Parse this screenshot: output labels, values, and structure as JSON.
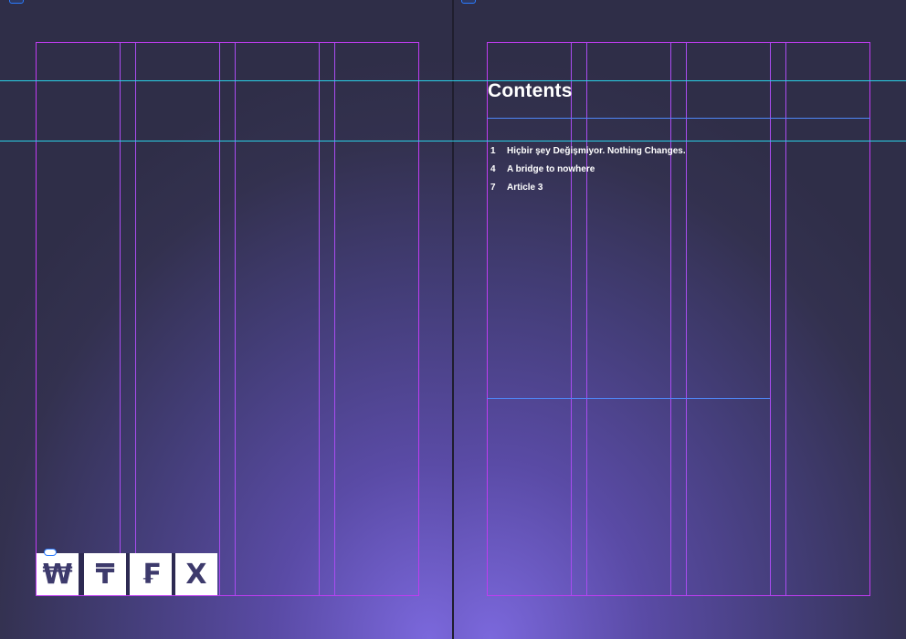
{
  "contents": {
    "title": "Contents",
    "entries": [
      {
        "page": "1",
        "title": "Hiçbir şey Değişmiyor. Nothing Changes."
      },
      {
        "page": "4",
        "title": "A bridge to nowhere"
      },
      {
        "page": "7",
        "title": "Article 3"
      }
    ]
  },
  "logo": {
    "glyphs": [
      "₩",
      "₸",
      "₣",
      "X"
    ]
  },
  "colors": {
    "margin_guide": "#c03cf2",
    "column_guide": "#a94cf0",
    "ruler_guide": "#2ad0e6",
    "frame_edge": "#4f86f7",
    "page_glow": "#7b68dc",
    "page_dark": "#2f2e48"
  }
}
